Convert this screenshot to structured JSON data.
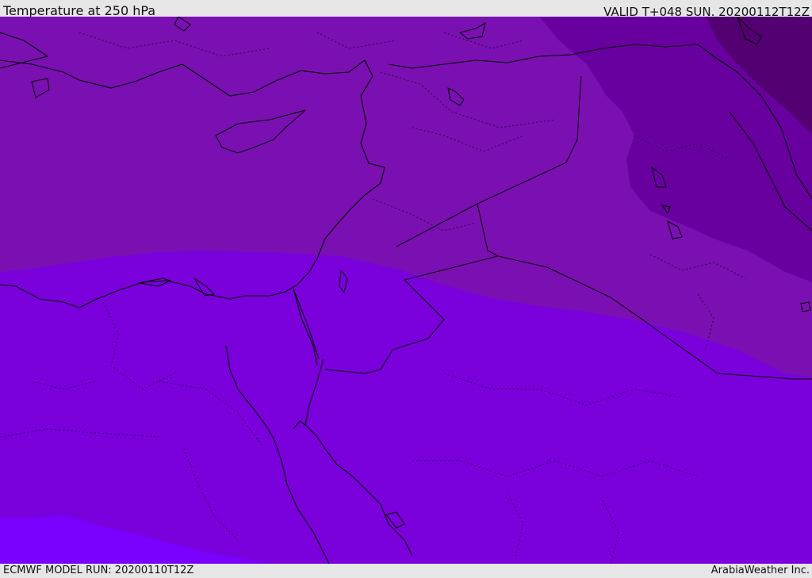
{
  "header": {
    "title": "Temperature at 250 hPa",
    "valid_time": "VALID T+048 SUN. 20200112T12Z"
  },
  "footer": {
    "model_run": "ECMWF MODEL RUN: 20200110T12Z",
    "credit": "ArabiaWeather Inc."
  },
  "map": {
    "colors": {
      "band_coldest": "#520072",
      "band_colder": "#6800a0",
      "band_cold": "#7a10b2",
      "band_mid": "#7a00dc",
      "band_warm": "#7800fc",
      "coastline": "#000000",
      "border": "#1a0033"
    }
  }
}
